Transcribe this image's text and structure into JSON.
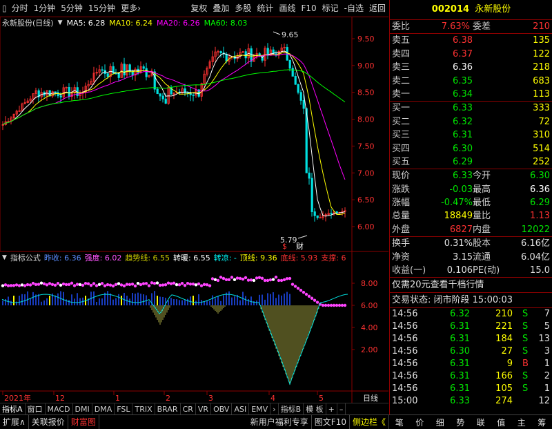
{
  "toolbar": {
    "left": [
      "分时",
      "1分钟",
      "5分钟",
      "15分钟",
      "更多›"
    ],
    "right": [
      "复权",
      "叠加",
      "多股",
      "统计",
      "画线",
      "F10",
      "标记",
      "-自选",
      "返回"
    ]
  },
  "chart": {
    "title": "永新股份(日线)",
    "ma": [
      {
        "label": "MA5: 6.28",
        "color": "#ffffff"
      },
      {
        "label": "MA10: 6.24",
        "color": "#ffff00"
      },
      {
        "label": "MA20: 6.26",
        "color": "#ff00ff"
      },
      {
        "label": "MA60: 8.03",
        "color": "#00ff00"
      }
    ],
    "y_ticks": [
      "9.50",
      "9.00",
      "8.50",
      "8.00",
      "7.50",
      "7.00",
      "6.50",
      "6.00"
    ],
    "high_label": "9.65",
    "low_label": "5.79",
    "markers": [
      "$",
      "财"
    ],
    "ind_y_ticks": [
      "8.00",
      "6.00",
      "4.00",
      "2.00"
    ],
    "date_labels": [
      "2021年",
      "12",
      "1",
      "2",
      "3",
      "4",
      "5"
    ],
    "date_axis_right": "日线"
  },
  "indicator": {
    "title": "指标公式",
    "items": [
      {
        "label": "昨收: 6.36",
        "color": "#5a8cff"
      },
      {
        "label": "强度: 6.02",
        "color": "#ff55ff"
      },
      {
        "label": "趋势线: 6.55",
        "color": "#c8c800"
      },
      {
        "label": "转暖: 6.55",
        "color": "#ffffff"
      },
      {
        "label": "转凉: -",
        "color": "#00ffff"
      },
      {
        "label": "顶线: 9.36",
        "color": "#ffff00"
      },
      {
        "label": "底线: 5.93",
        "color": "#ff3232"
      },
      {
        "label": "支撑: 6",
        "color": "#ff3232"
      }
    ]
  },
  "tabs": [
    "指标A",
    "窗口",
    "MACD",
    "DMI",
    "DMA",
    "FSL",
    "TRIX",
    "BRAR",
    "CR",
    "VR",
    "OBV",
    "ASI",
    "EMV",
    "›",
    "指标B",
    "模 板",
    "+",
    "–"
  ],
  "status": {
    "left": [
      "扩展∧",
      "关联报价",
      "财富图"
    ],
    "right": [
      "新用户福利专享",
      "图文F10",
      "侧边栏《"
    ],
    "nav": [
      "笔",
      "价",
      "细",
      "势",
      "联",
      "值",
      "主",
      "筹"
    ]
  },
  "panel": {
    "code": "002014",
    "name": "永新股份",
    "weibi_label": "委比",
    "weibi": "7.63%",
    "weicha_label": "委差",
    "weicha": "210",
    "asks": [
      {
        "label": "卖五",
        "price": "6.38",
        "vol": "135",
        "pc": "#ff3232"
      },
      {
        "label": "卖四",
        "price": "6.37",
        "vol": "122",
        "pc": "#ff3232"
      },
      {
        "label": "卖三",
        "price": "6.36",
        "vol": "218",
        "pc": "#ffffff"
      },
      {
        "label": "卖二",
        "price": "6.35",
        "vol": "683",
        "pc": "#00e600"
      },
      {
        "label": "卖一",
        "price": "6.34",
        "vol": "113",
        "pc": "#00e600"
      }
    ],
    "bids": [
      {
        "label": "买一",
        "price": "6.33",
        "vol": "333",
        "pc": "#00e600"
      },
      {
        "label": "买二",
        "price": "6.32",
        "vol": "72",
        "pc": "#00e600"
      },
      {
        "label": "买三",
        "price": "6.31",
        "vol": "310",
        "pc": "#00e600"
      },
      {
        "label": "买四",
        "price": "6.30",
        "vol": "514",
        "pc": "#00e600"
      },
      {
        "label": "买五",
        "price": "6.29",
        "vol": "252",
        "pc": "#00e600"
      }
    ],
    "quote": [
      {
        "l1": "现价",
        "v1": "6.33",
        "c1": "#00e600",
        "l2": "今开",
        "v2": "6.30",
        "c2": "#00e600"
      },
      {
        "l1": "涨跌",
        "v1": "-0.03",
        "c1": "#00e600",
        "l2": "最高",
        "v2": "6.36",
        "c2": "#ffffff"
      },
      {
        "l1": "涨幅",
        "v1": "-0.47%",
        "c1": "#00e600",
        "l2": "最低",
        "v2": "6.29",
        "c2": "#00e600"
      },
      {
        "l1": "总量",
        "v1": "18849",
        "c1": "#ffff00",
        "l2": "量比",
        "v2": "1.13",
        "c2": "#ff3232"
      },
      {
        "l1": "外盘",
        "v1": "6827",
        "c1": "#ff3232",
        "l2": "内盘",
        "v2": "12022",
        "c2": "#00e600"
      }
    ],
    "fund": [
      {
        "l1": "换手",
        "v1": "0.31%",
        "l2": "股本",
        "v2": "6.16亿"
      },
      {
        "l1": "净资",
        "v1": "3.15",
        "l2": "流通",
        "v2": "6.04亿"
      },
      {
        "l1": "收益(一)",
        "v1": "0.106",
        "l2": "PE(动)",
        "v2": "15.0"
      }
    ],
    "promo": "仅需20元查看千档行情",
    "trade_status": "交易状态: 闭市阶段 15:00:03",
    "ticks": [
      {
        "t": "14:56",
        "p": "6.32",
        "v": "210",
        "bs": "S",
        "n": "7",
        "bsc": "#00e600"
      },
      {
        "t": "14:56",
        "p": "6.31",
        "v": "221",
        "bs": "S",
        "n": "5",
        "bsc": "#00e600"
      },
      {
        "t": "14:56",
        "p": "6.31",
        "v": "184",
        "bs": "S",
        "n": "13",
        "bsc": "#00e600"
      },
      {
        "t": "14:56",
        "p": "6.30",
        "v": "27",
        "bs": "S",
        "n": "3",
        "bsc": "#00e600"
      },
      {
        "t": "14:56",
        "p": "6.31",
        "v": "9",
        "bs": "B",
        "n": "1",
        "bsc": "#ff3232"
      },
      {
        "t": "14:56",
        "p": "6.31",
        "v": "166",
        "bs": "S",
        "n": "2",
        "bsc": "#00e600"
      },
      {
        "t": "14:56",
        "p": "6.31",
        "v": "105",
        "bs": "S",
        "n": "1",
        "bsc": "#00e600"
      },
      {
        "t": "15:00",
        "p": "6.33",
        "v": "274",
        "bs": "",
        "n": "12",
        "bsc": "#00e600"
      }
    ]
  }
}
